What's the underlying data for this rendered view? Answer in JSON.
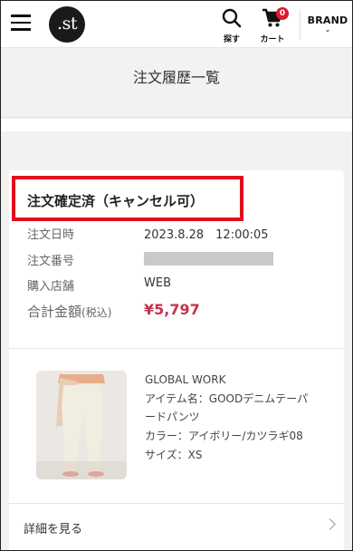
{
  "header": {
    "logo_text": ".st",
    "search_label": "探す",
    "cart_label": "カート",
    "cart_count": "0",
    "brand_label": "BRAND",
    "brand_chevron": "⌄",
    "accent_color": "#e0182d"
  },
  "page": {
    "title": "注文履歴一覧"
  },
  "order": {
    "status": "注文確定済（キャンセル可）",
    "fields": [
      {
        "label": "注文日時",
        "value": "2023.8.28　12:00:05"
      },
      {
        "label": "注文番号",
        "value": ""
      },
      {
        "label": "購入店舗",
        "value": "WEB"
      }
    ],
    "total_label": "合計金額",
    "total_label_note": "(税込)",
    "total_value": "¥5,797",
    "total_color": "#c8324b",
    "highlight_color": "#e0101d"
  },
  "item": {
    "brand": "GLOBAL WORK",
    "name_line1": "アイテム名：GOODデニムテーパ",
    "name_line2": "ードパンツ",
    "color": "カラー：アイボリー/カツラギ08",
    "size": "サイズ：XS"
  },
  "footer": {
    "detail_link": "詳細を見る"
  },
  "icons": [
    "menu-icon",
    "search-icon",
    "cart-icon",
    "chevron-down-icon",
    "chevron-right-icon"
  ]
}
